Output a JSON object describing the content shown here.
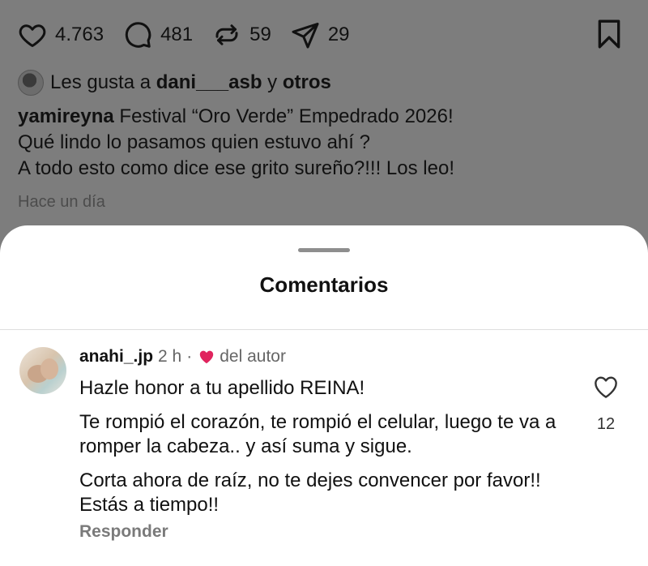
{
  "post": {
    "likes_count": "4.763",
    "comments_count": "481",
    "reposts_count": "59",
    "shares_count": "29",
    "liked_by_prefix": "Les gusta a ",
    "liked_by_user": "dani___asb",
    "liked_by_join": " y ",
    "liked_by_others": "otros",
    "caption_user": "yamireyna",
    "caption_lines": [
      " Festival “Oro Verde” Empedrado 2026!",
      "Qué lindo lo pasamos quien estuvo ahí ?",
      "A todo esto como dice ese grito sureño?!!! Los leo!"
    ],
    "time": "Hace un día"
  },
  "comments_sheet": {
    "title": "Comentarios",
    "comment": {
      "username": "anahi_.jp",
      "time": "2 h",
      "separator": "·",
      "author_badge": "del autor",
      "paragraphs": [
        "Hazle honor a tu apellido REINA!",
        "Te rompió el corazón, te rompió el celular, luego te va a romper la cabeza.. y así suma y sigue.",
        "Corta ahora de raíz, no te dejes convencer por favor!! Estás a tiempo!!"
      ],
      "reply_label": "Responder",
      "like_count": "12"
    }
  },
  "colors": {
    "overlay": "#7d7d7d",
    "sheet": "#ffffff",
    "heart_red": "#e0245e"
  },
  "icons": [
    "heart-icon",
    "comment-icon",
    "repost-icon",
    "share-icon",
    "bookmark-icon",
    "author-heart-icon",
    "comment-like-icon"
  ]
}
